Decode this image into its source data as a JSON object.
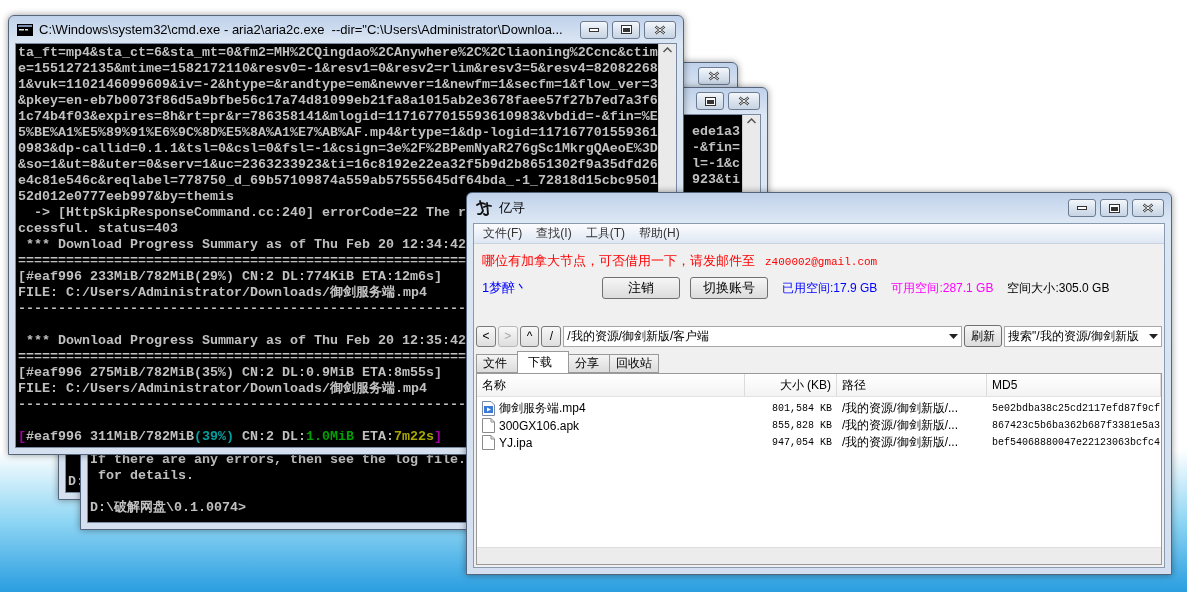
{
  "back_console_1": {
    "blocks": [
      [
        "D:"
      ]
    ]
  },
  "back_console_2": {
    "side_lines": [
      "ede1a3",
      "-&fin=",
      "l=-1&c",
      "923&ti"
    ],
    "blocks": [
      [
        "If there are any errors, then see the log file.",
        " for details."
      ],
      [
        "D:\\破解网盘\\0.1.0074>"
      ]
    ]
  },
  "console": {
    "title": "C:\\Windows\\system32\\cmd.exe - aria2\\aria2c.exe  --dir=\"C:\\Users\\Administrator\\Downloa...",
    "blocks": [
      [
        "ta_ft=mp4&sta_ct=6&sta_mt=0&fm2=MH%2CQingdao%2CAnywhere%2C%2Cliaoning%2Ccnc&ctim",
        "e=1551272135&mtime=1582172110&resv0=-1&resv1=0&resv2=rlim&resv3=5&resv4=82082268",
        "1&vuk=1102146099609&iv=-2&htype=&randtype=em&newver=1&newfm=1&secfm=1&flow_ver=3",
        "&pkey=en-eb7b0073f86d5a9bfbe56c17a74d81099eb21fa8a1015ab2e3678faee57f27b7ed7a3f6",
        "1c74b4f03&expires=8h&rt=pr&r=786358141&mlogid=1171677015593610983&vbdid=-&fin=%E",
        "5%BE%A1%E5%89%91%E6%9C%8D%E5%8A%A1%E7%AB%AF.mp4&rtype=1&dp-logid=117167701559361",
        "0983&dp-callid=0.1.1&tsl=0&csl=0&fsl=-1&csign=3e%2F%2BPemNyaR276gSc1MkrgQAeoE%3D",
        "&so=1&ut=8&uter=0&serv=1&uc=2363233923&ti=16c8192e22ea32f5b9d2b8651302f9a35dfd26",
        "e4c81e546c&reqlabel=778750_d_69b57109874a559ab57555645df64bda_-1_72818d15cbc9501",
        "52d012e0777eeb997&by=themis",
        "  -> [HttpSkipResponseCommand.cc:240] errorCode=22 The r",
        "ccessful. status=403",
        " *** Download Progress Summary as of Thu Feb 20 12:34:42",
        "========================================================",
        "[#eaf996 233MiB/782MiB(29%) CN:2 DL:774KiB ETA:12m6s]",
        "FILE: C:/Users/Administrator/Downloads/御剑服务端.mp4",
        "--------------------------------------------------------"
      ],
      [
        " *** Download Progress Summary as of Thu Feb 20 12:35:42",
        "========================================================",
        "[#eaf996 275MiB/782MiB(35%) CN:2 DL:0.9MiB ETA:8m55s]",
        "FILE: C:/Users/Administrator/Downloads/御剑服务端.mp4",
        "--------------------------------------------------------"
      ]
    ],
    "progress_line": [
      {
        "text": "[",
        "color": "#a000a0"
      },
      {
        "text": "#eaf996 311MiB/782MiB",
        "color": "#c0c0c0"
      },
      {
        "text": "(39%)",
        "color": "#00a0a0"
      },
      {
        "text": " CN:2 DL:",
        "color": "#c0c0c0"
      },
      {
        "text": "1.0MiB",
        "color": "#00a000"
      },
      {
        "text": " ETA:",
        "color": "#c0c0c0"
      },
      {
        "text": "7m22s",
        "color": "#a8a800"
      },
      {
        "text": "]",
        "color": "#a000a0"
      }
    ]
  },
  "app": {
    "title": "亿寻",
    "menu": [
      "文件(F)",
      "查找(I)",
      "工具(T)",
      "帮助(H)"
    ],
    "notice": {
      "text": "哪位有加拿大节点，可否借用一下，请发邮件至",
      "email": "z400002@gmail.com"
    },
    "user": "1梦醉丶",
    "buttons": [
      "注销",
      "切换账号"
    ],
    "quotas": [
      {
        "text": "已用空间:17.9 GB",
        "color": "#0000ff"
      },
      {
        "text": "可用空间:287.1 GB",
        "color": "#ff00ff"
      },
      {
        "text": "空间大小:305.0 GB",
        "color": "#000000"
      }
    ],
    "nav": [
      {
        "label": "<",
        "disabled": false
      },
      {
        "label": ">",
        "disabled": true
      },
      {
        "label": "^",
        "disabled": false
      },
      {
        "label": "/",
        "disabled": false
      }
    ],
    "path": "/我的资源/御剑新版/客户端",
    "refresh": "刷新",
    "search": "搜索\"/我的资源/御剑新版",
    "tabs": [
      {
        "label": "文件",
        "selected": false
      },
      {
        "label": "下载",
        "selected": true
      },
      {
        "label": "分享",
        "selected": false
      },
      {
        "label": "回收站",
        "selected": false
      }
    ],
    "table": {
      "columns": [
        "名称",
        "大小 (KB)",
        "路径",
        "MD5"
      ],
      "rows": [
        {
          "kind": "video",
          "name": "御剑服务端.mp4",
          "size": "801,584 KB",
          "path": "/我的资源/御剑新版/...",
          "md5": "5e02bdba38c25cd2117efd87f9cf"
        },
        {
          "kind": "file",
          "name": "300GX106.apk",
          "size": "855,828 KB",
          "path": "/我的资源/御剑新版/...",
          "md5": "867423c5b6ba362b687f3381e5a3"
        },
        {
          "kind": "file",
          "name": "YJ.ipa",
          "size": "947,054 KB",
          "path": "/我的资源/御剑新版/...",
          "md5": "bef54068880047e22123063bcfc4"
        }
      ]
    }
  }
}
